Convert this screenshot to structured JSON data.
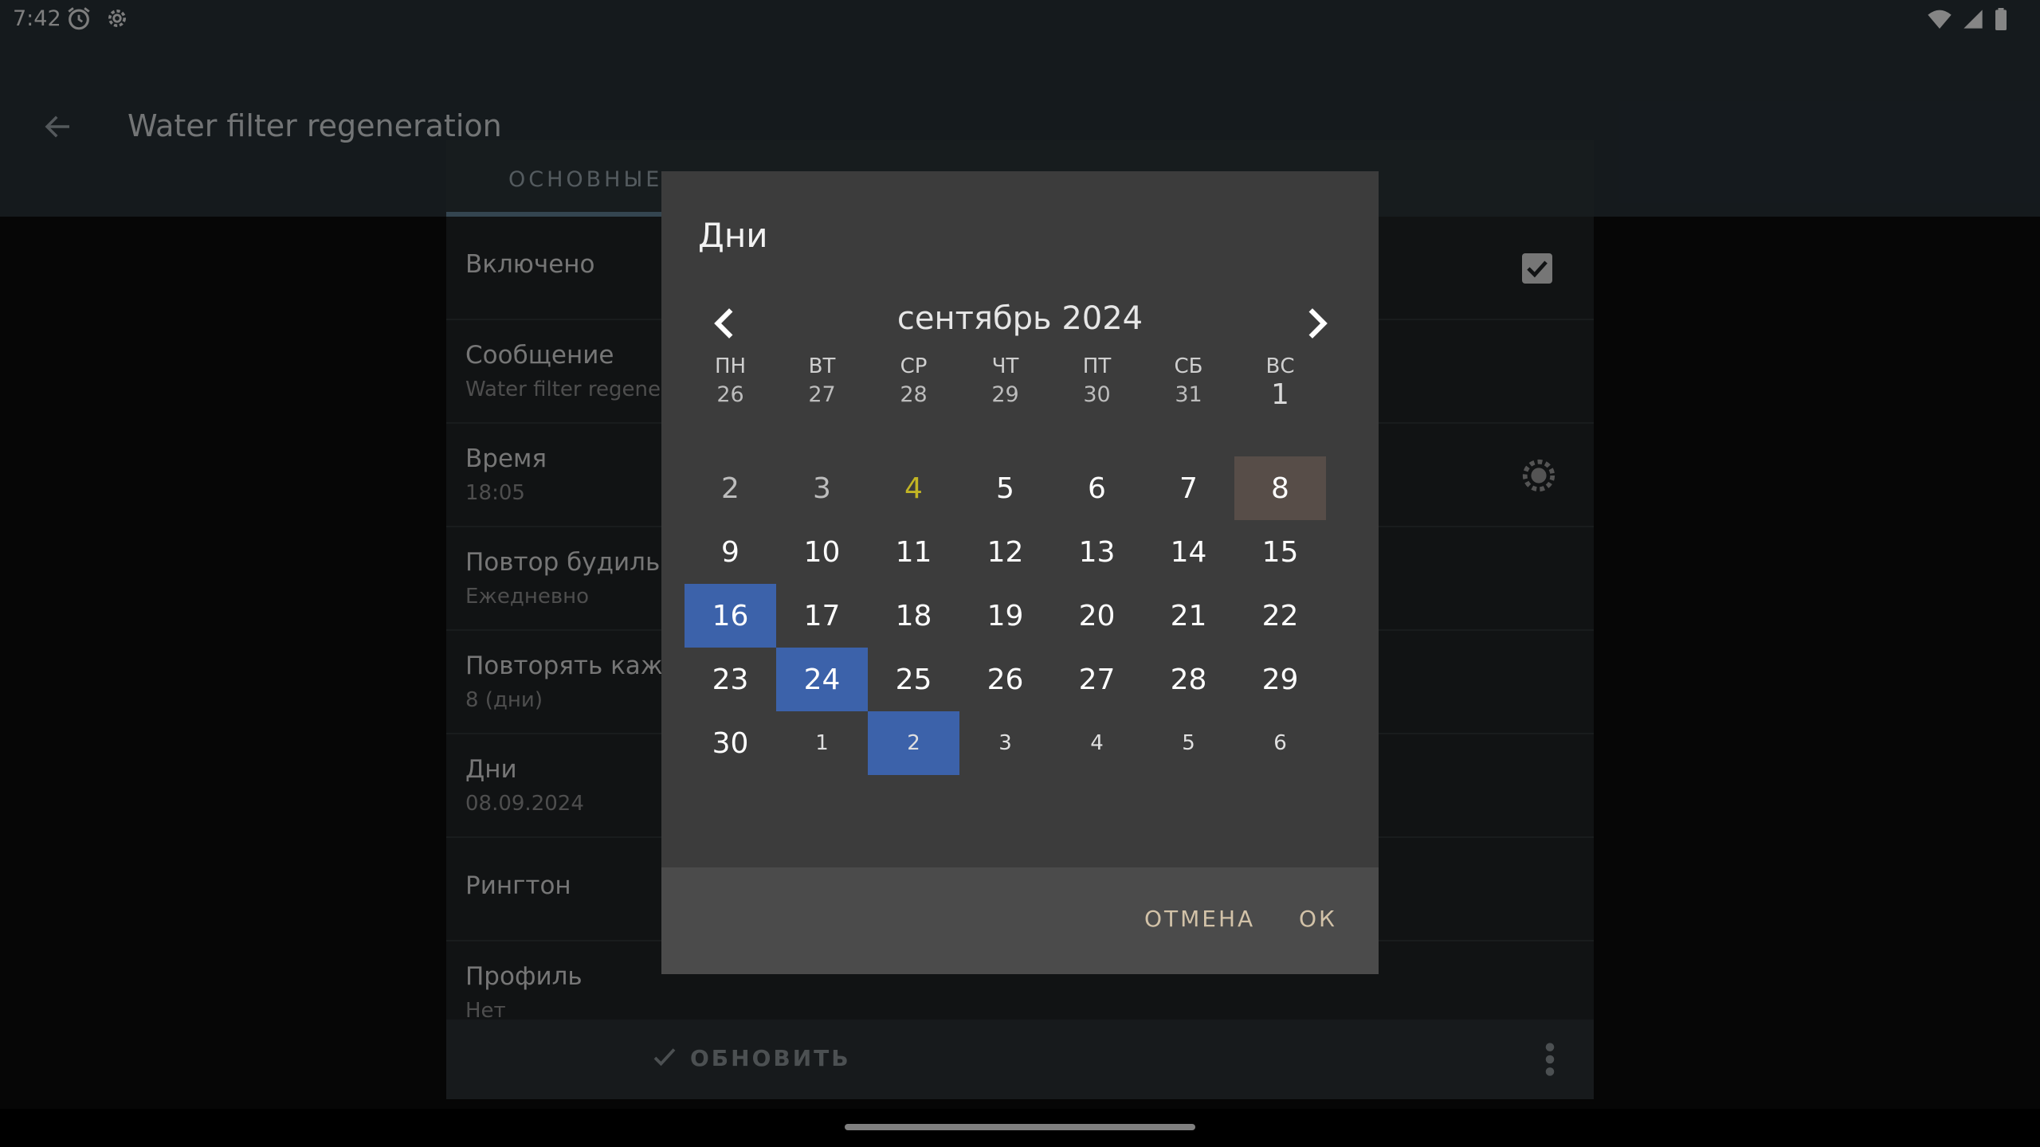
{
  "status_bar": {
    "time": "7:42"
  },
  "toolbar": {
    "title": "Water filter regeneration"
  },
  "tabs": {
    "main": "ОСНОВНЫЕ"
  },
  "settings": [
    {
      "title": "Включено",
      "subtitle": ""
    },
    {
      "title": "Сообщение",
      "subtitle": "Water filter regeneration"
    },
    {
      "title": "Время",
      "subtitle": "18:05"
    },
    {
      "title": "Повтор будильника",
      "subtitle": "Ежедневно"
    },
    {
      "title": "Повторять каждые",
      "subtitle": "8 (дни)"
    },
    {
      "title": "Дни",
      "subtitle": "08.09.2024"
    },
    {
      "title": "Рингтон",
      "subtitle": ""
    },
    {
      "title": "Профиль",
      "subtitle": "Нет"
    }
  ],
  "bottom_bar": {
    "update_label": "ОБНОВИТЬ"
  },
  "dialog": {
    "title": "Дни",
    "month_label": "сентябрь 2024",
    "weekdays": [
      "ПН",
      "ВТ",
      "СР",
      "ЧТ",
      "ПТ",
      "СБ",
      "ВС"
    ],
    "weeks": [
      [
        {
          "label": "26",
          "kind": "faded"
        },
        {
          "label": "27",
          "kind": "faded"
        },
        {
          "label": "28",
          "kind": "faded"
        },
        {
          "label": "29",
          "kind": "faded"
        },
        {
          "label": "30",
          "kind": "faded"
        },
        {
          "label": "31",
          "kind": "faded"
        },
        {
          "label": "1",
          "kind": "first-current"
        }
      ],
      [
        {
          "label": "2",
          "kind": "faded-big"
        },
        {
          "label": "3",
          "kind": "faded-big"
        },
        {
          "label": "4",
          "kind": "today"
        },
        {
          "label": "5",
          "kind": "normal"
        },
        {
          "label": "6",
          "kind": "normal"
        },
        {
          "label": "7",
          "kind": "normal"
        },
        {
          "label": "8",
          "kind": "primary"
        }
      ],
      [
        {
          "label": "9",
          "kind": "normal"
        },
        {
          "label": "10",
          "kind": "normal"
        },
        {
          "label": "11",
          "kind": "normal"
        },
        {
          "label": "12",
          "kind": "normal"
        },
        {
          "label": "13",
          "kind": "normal"
        },
        {
          "label": "14",
          "kind": "normal"
        },
        {
          "label": "15",
          "kind": "normal"
        }
      ],
      [
        {
          "label": "16",
          "kind": "selected"
        },
        {
          "label": "17",
          "kind": "normal"
        },
        {
          "label": "18",
          "kind": "normal"
        },
        {
          "label": "19",
          "kind": "normal"
        },
        {
          "label": "20",
          "kind": "normal"
        },
        {
          "label": "21",
          "kind": "normal"
        },
        {
          "label": "22",
          "kind": "normal"
        }
      ],
      [
        {
          "label": "23",
          "kind": "normal"
        },
        {
          "label": "24",
          "kind": "selected"
        },
        {
          "label": "25",
          "kind": "normal"
        },
        {
          "label": "26",
          "kind": "normal"
        },
        {
          "label": "27",
          "kind": "normal"
        },
        {
          "label": "28",
          "kind": "normal"
        },
        {
          "label": "29",
          "kind": "normal"
        }
      ],
      [
        {
          "label": "30",
          "kind": "normal"
        },
        {
          "label": "1",
          "kind": "next"
        },
        {
          "label": "2",
          "kind": "next-selected"
        },
        {
          "label": "3",
          "kind": "next"
        },
        {
          "label": "4",
          "kind": "next"
        },
        {
          "label": "5",
          "kind": "next"
        },
        {
          "label": "6",
          "kind": "next"
        }
      ]
    ],
    "cancel_label": "ОТМЕНА",
    "ok_label": "ОК"
  },
  "colors": {
    "selected": "#3c62aa",
    "primary_day": "#574d48",
    "today": "#c2b524",
    "dialog_bg": "#3c3c3c",
    "button_text": "#d2c2a8"
  }
}
